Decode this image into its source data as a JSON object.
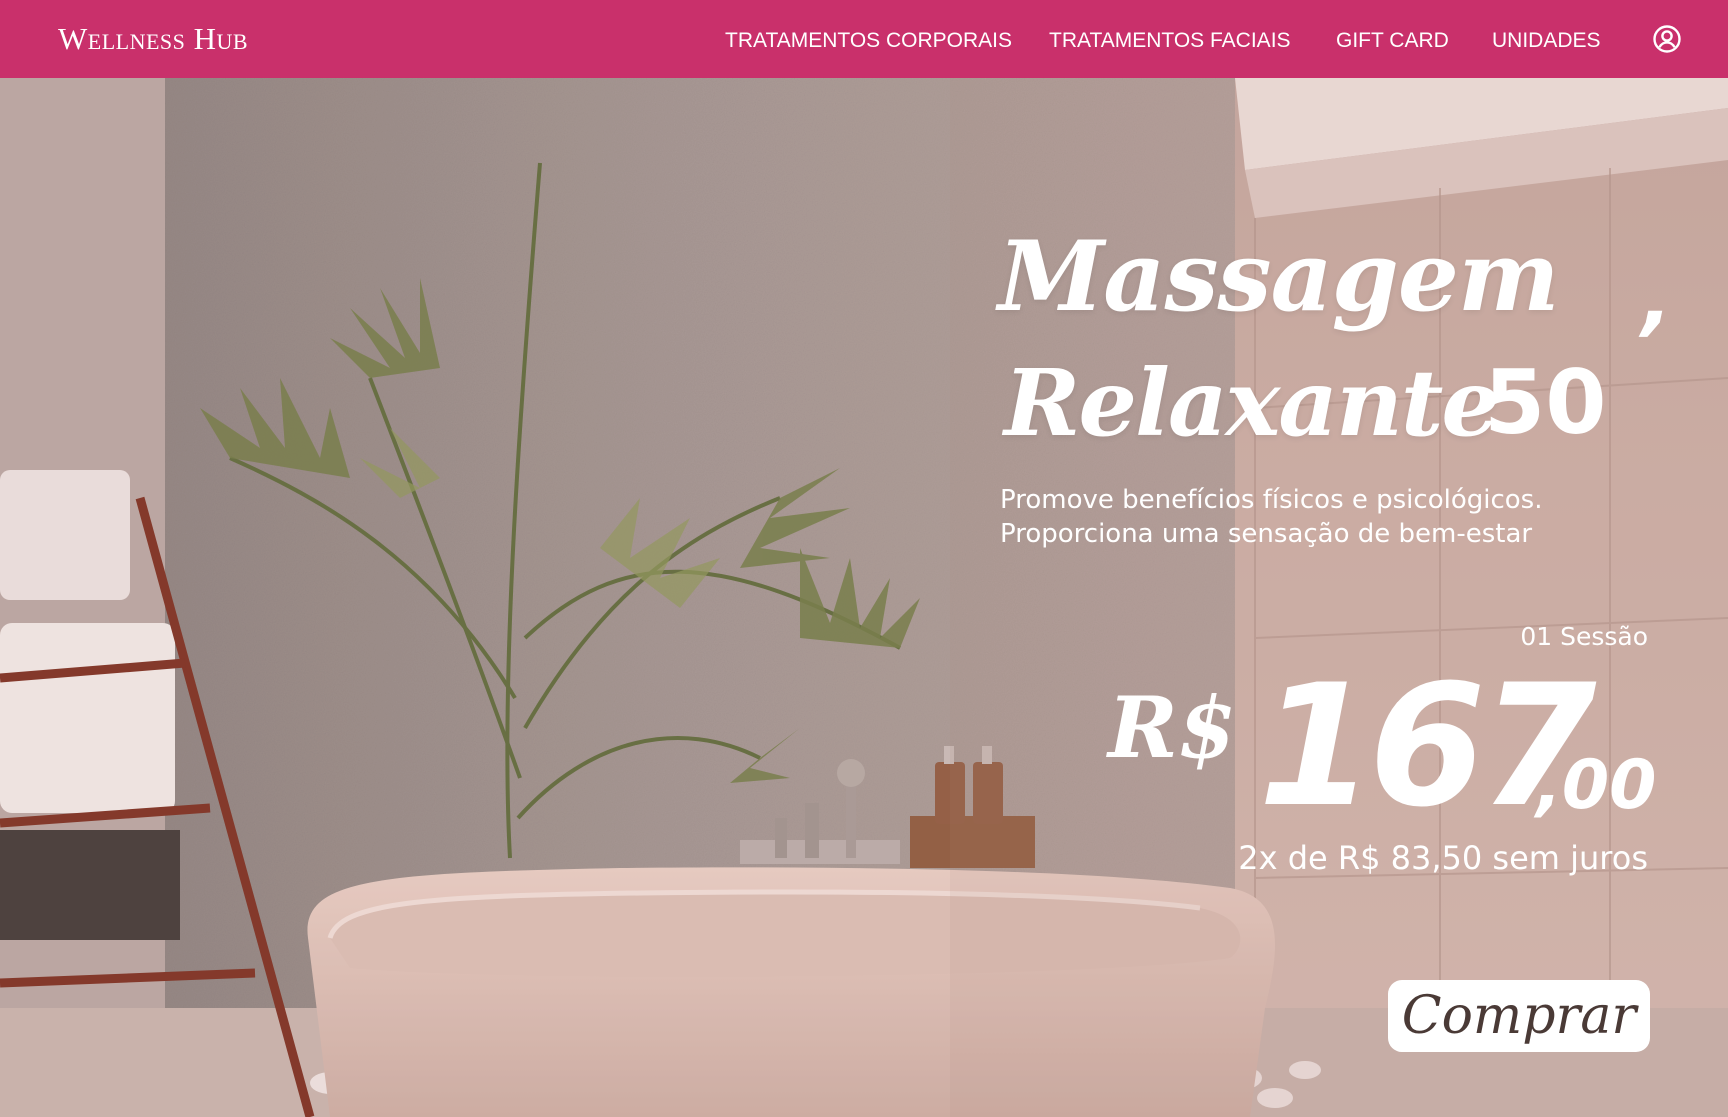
{
  "brand": {
    "logo_text": "Wellness Hub",
    "primary_color": "#c9306b"
  },
  "nav": {
    "items": [
      {
        "label": "TRATAMENTOS CORPORAIS"
      },
      {
        "label": "TRATAMENTOS FACIAIS"
      },
      {
        "label": "GIFT CARD"
      },
      {
        "label": "UNIDADES"
      }
    ],
    "account_icon": "user-circle-icon"
  },
  "hero": {
    "title_line1": "Massagem",
    "title_line2": "Relaxante",
    "title_suffix": "50",
    "title_apostrophe": "’",
    "description_line1": "Promove benefícios físicos e psicológicos.",
    "description_line2": "Proporciona uma sensação de bem-estar",
    "session_label": "01 Sessão",
    "currency": "R$",
    "price_integer": "167",
    "price_cents": ",00",
    "installments": "2x de  R$ 83,50 sem juros",
    "buy_label": "Comprar"
  }
}
